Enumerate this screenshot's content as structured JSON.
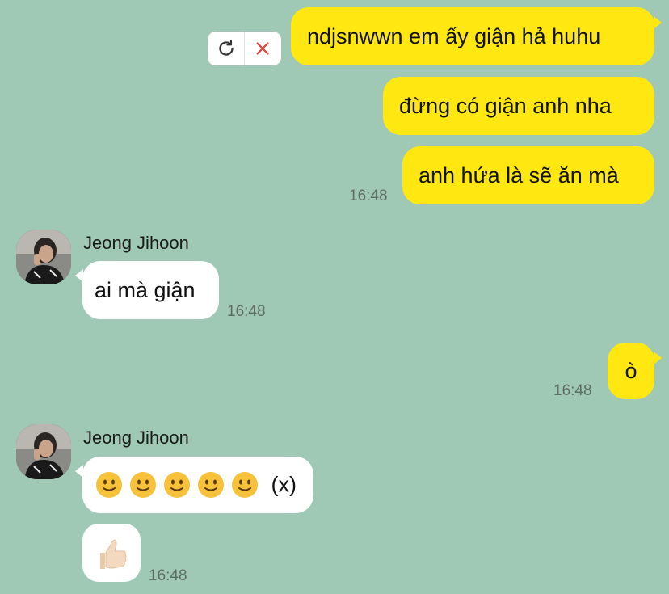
{
  "messages_out": [
    {
      "text": "ndjsnwwn em ấy giận hả huhu"
    },
    {
      "text": "đừng có giận anh nha"
    },
    {
      "text": "anh hứa là sẽ ăn mà",
      "time": "16:48"
    },
    {
      "text": "ò",
      "time": "16:48"
    }
  ],
  "groups_in": [
    {
      "sender": "Jeong Jihoon",
      "messages": [
        {
          "text": "ai mà giận",
          "time": "16:48"
        }
      ]
    },
    {
      "sender": "Jeong Jihoon",
      "messages": [
        {
          "emoji_count": 5,
          "emoji": "slightly-smiling-face-icon",
          "suffix": "(x)"
        },
        {
          "emoji": "thumbs-up-icon",
          "time": "16:48"
        }
      ]
    }
  ],
  "failed_actions": {
    "retry_icon": "retry-icon",
    "delete_icon": "close-icon"
  },
  "colors": {
    "background": "#9fc8b5",
    "outgoing_bubble": "#ffe812",
    "incoming_bubble": "#ffffff",
    "delete_red": "#e0453a"
  }
}
